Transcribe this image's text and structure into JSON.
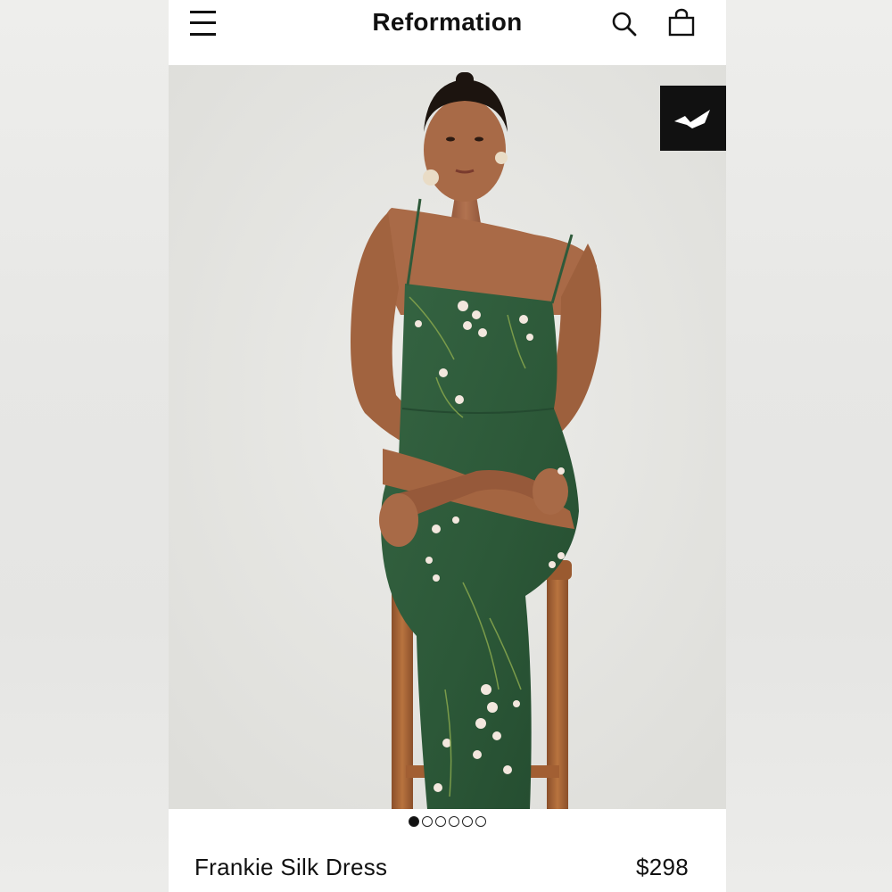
{
  "header": {
    "brand": "Reformation",
    "menu_icon": "hamburger-menu-icon",
    "search_icon": "search-icon",
    "bag_icon": "shopping-bag-icon"
  },
  "hero": {
    "image_alt": "Model in green floral silk slip dress seated on wooden stool",
    "badge_icon": "checkmark-logo-icon",
    "colors": {
      "dress": "#2f5a3a",
      "skin": "#a86a47",
      "stool": "#a8643a",
      "badge_bg": "#111111"
    }
  },
  "carousel": {
    "total": 6,
    "active": 1
  },
  "product": {
    "name": "Frankie Silk Dress",
    "price": "$298"
  }
}
